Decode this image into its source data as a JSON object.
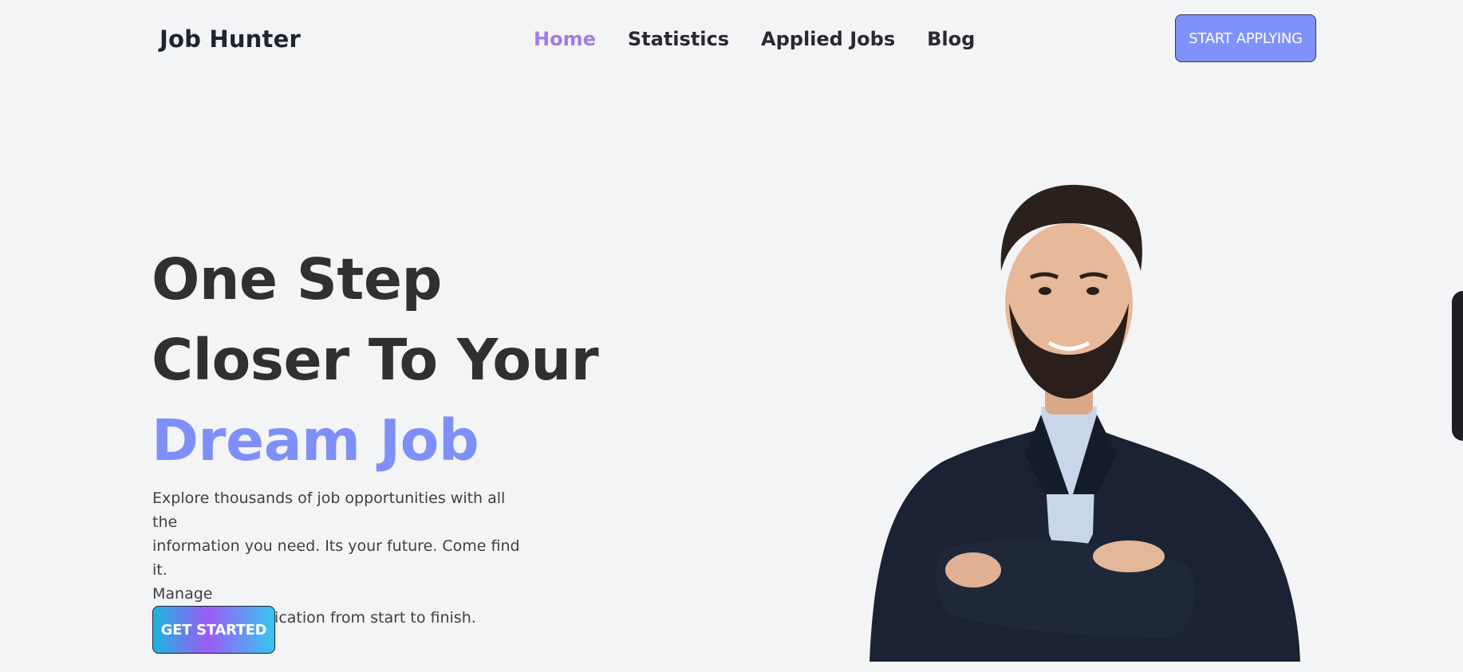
{
  "header": {
    "logo": "Job Hunter",
    "nav": [
      {
        "label": "Home",
        "active": true
      },
      {
        "label": "Statistics",
        "active": false
      },
      {
        "label": "Applied Jobs",
        "active": false
      },
      {
        "label": "Blog",
        "active": false
      }
    ],
    "cta_label": "START APPLYING"
  },
  "hero": {
    "title_line1": "One Step",
    "title_line2": "Closer To Your",
    "title_accent": "Dream Job",
    "description": [
      "Explore thousands of job opportunities with all the",
      "information you need. Its your future. Come find it.",
      "Manage",
      "all your job application from start to finish."
    ],
    "cta_label": "GET STARTED",
    "image_alt_icon": "person-photo"
  },
  "colors": {
    "accent": "#7f8ff8",
    "nav_active": "#a07ce8",
    "background": "#f3f4f6",
    "text": "#303030"
  }
}
